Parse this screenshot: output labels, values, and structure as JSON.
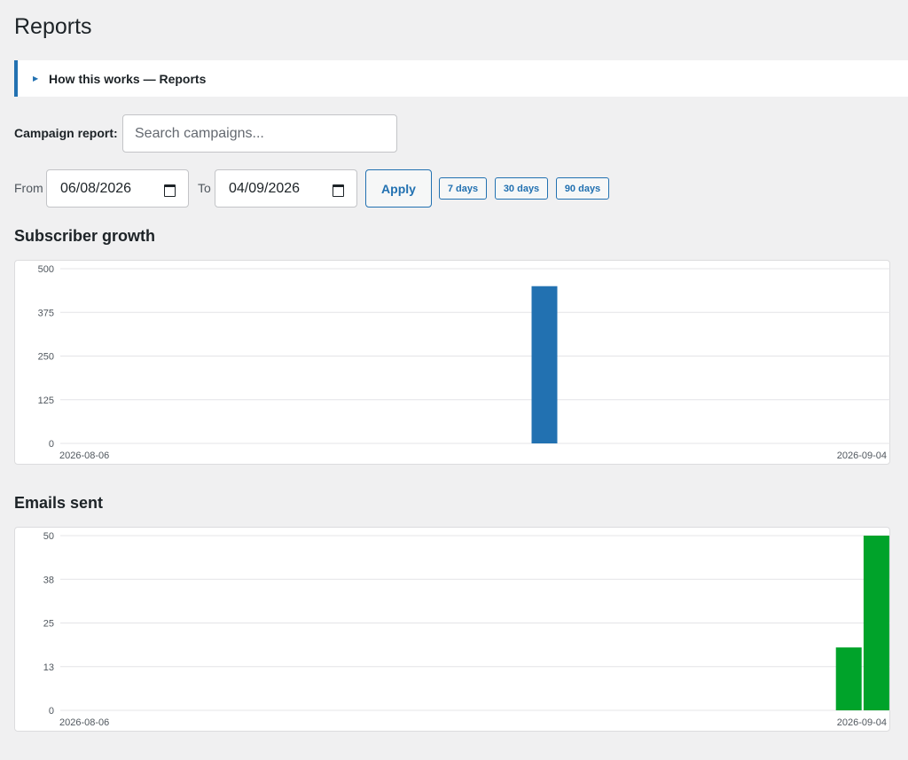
{
  "page": {
    "title": "Reports"
  },
  "howto": {
    "label": "How this works — Reports"
  },
  "campaign": {
    "label": "Campaign report:",
    "placeholder": "Search campaigns..."
  },
  "range": {
    "from_label": "From",
    "from_value": "06/08/2026",
    "to_label": "To",
    "to_value": "04/09/2026",
    "apply_label": "Apply",
    "presets": [
      "7 days",
      "30 days",
      "90 days"
    ]
  },
  "colors": {
    "accent": "#2271b1",
    "subscriber_bar": "#2271b1",
    "emails_bar": "#00a32a"
  },
  "chart_data": [
    {
      "type": "bar",
      "title": "Subscriber growth",
      "x": [
        "2026-08-06",
        "2026-09-04"
      ],
      "x_start": "2026-08-06",
      "x_end": "2026-09-04",
      "bars": [
        {
          "x": "2026-08-23",
          "value": 450
        }
      ],
      "yticks": [
        "0",
        "125",
        "250",
        "375",
        "500"
      ],
      "ylim": [
        0,
        500
      ],
      "grid": true,
      "color": "#2271b1"
    },
    {
      "type": "bar",
      "title": "Emails sent",
      "x": [
        "2026-08-06",
        "2026-09-04"
      ],
      "x_start": "2026-08-06",
      "x_end": "2026-09-04",
      "bars": [
        {
          "x": "2026-09-03",
          "value": 18
        },
        {
          "x": "2026-09-04",
          "value": 50
        }
      ],
      "yticks": [
        "0",
        "13",
        "25",
        "38",
        "50"
      ],
      "ylim": [
        0,
        50
      ],
      "grid": true,
      "color": "#00a32a"
    }
  ]
}
